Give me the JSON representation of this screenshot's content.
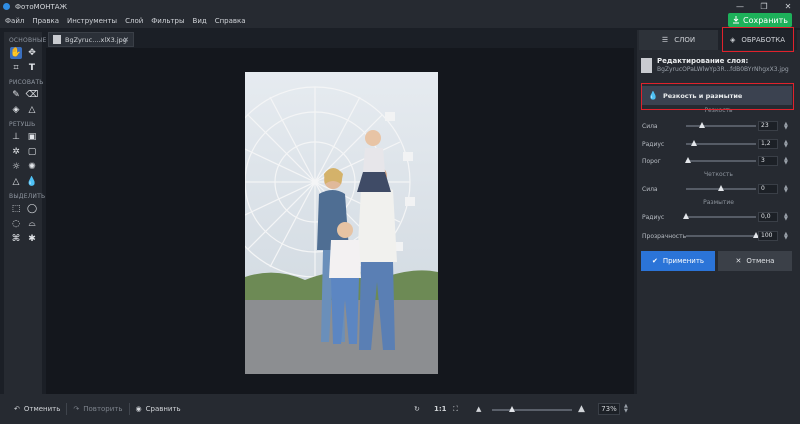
{
  "window": {
    "title": "ФотоМОНТАЖ",
    "controls": [
      "—",
      "❐",
      "✕"
    ]
  },
  "menu": {
    "items": [
      "Файл",
      "Правка",
      "Инструменты",
      "Слой",
      "Фильтры",
      "Вид",
      "Справка"
    ]
  },
  "save_button": {
    "label": "Сохранить"
  },
  "tools": {
    "groups": [
      {
        "label": "ОСНОВНЫЕ",
        "icons": [
          "hand-icon",
          "move-icon",
          "crop-icon",
          "text-icon"
        ]
      },
      {
        "label": "РИСОВАТЬ",
        "icons": [
          "brush-icon",
          "eraser-icon",
          "fill-icon",
          "shapes-icon"
        ]
      },
      {
        "label": "РЕТУШЬ",
        "icons": [
          "stamp-icon",
          "patch-icon",
          "heal-icon",
          "frame-icon",
          "dodge-icon",
          "burn-icon",
          "sharpen-icon",
          "blur-drop-icon"
        ]
      },
      {
        "label": "ВЫДЕЛИТЬ",
        "icons": [
          "rect-select-icon",
          "ellipse-select-icon",
          "lasso-icon",
          "poly-lasso-icon",
          "magic-select-icon",
          "wand-icon"
        ]
      }
    ]
  },
  "document_tab": {
    "name": "BgZyruc....xlX3.jpg",
    "close": "✕"
  },
  "bottom": {
    "undo": "Отменить",
    "redo": "Повторить",
    "compare": "Сравнить",
    "ratio": "1:1",
    "zoom": "73%",
    "zoom_level": 0.25
  },
  "panel": {
    "tabs": {
      "layers": "СЛОИ",
      "processing": "ОБРАБОТКА"
    },
    "layer_title": "Редактирование слоя:",
    "layer_file": "BgZyrucOPaLWlwYp3R...fdB0BYrNhgxX3.jpg",
    "section": "Резкость и размытие",
    "sharpness": {
      "title": "Резкость",
      "params": [
        {
          "label": "Сила",
          "value": "23",
          "level": 0.23
        },
        {
          "label": "Радиус",
          "value": "1,2",
          "level": 0.12
        },
        {
          "label": "Порог",
          "value": "3",
          "level": 0.03
        }
      ]
    },
    "clarity": {
      "title": "Четкость",
      "params": [
        {
          "label": "Сила",
          "value": "0",
          "level": 0.5
        }
      ]
    },
    "blur": {
      "title": "Размытие",
      "params": [
        {
          "label": "Радиус",
          "value": "0,0",
          "level": 0.0
        },
        {
          "label": "Прозрачность",
          "value": "100",
          "level": 1.0
        }
      ]
    },
    "apply": "Применить",
    "cancel": "Отмена"
  }
}
